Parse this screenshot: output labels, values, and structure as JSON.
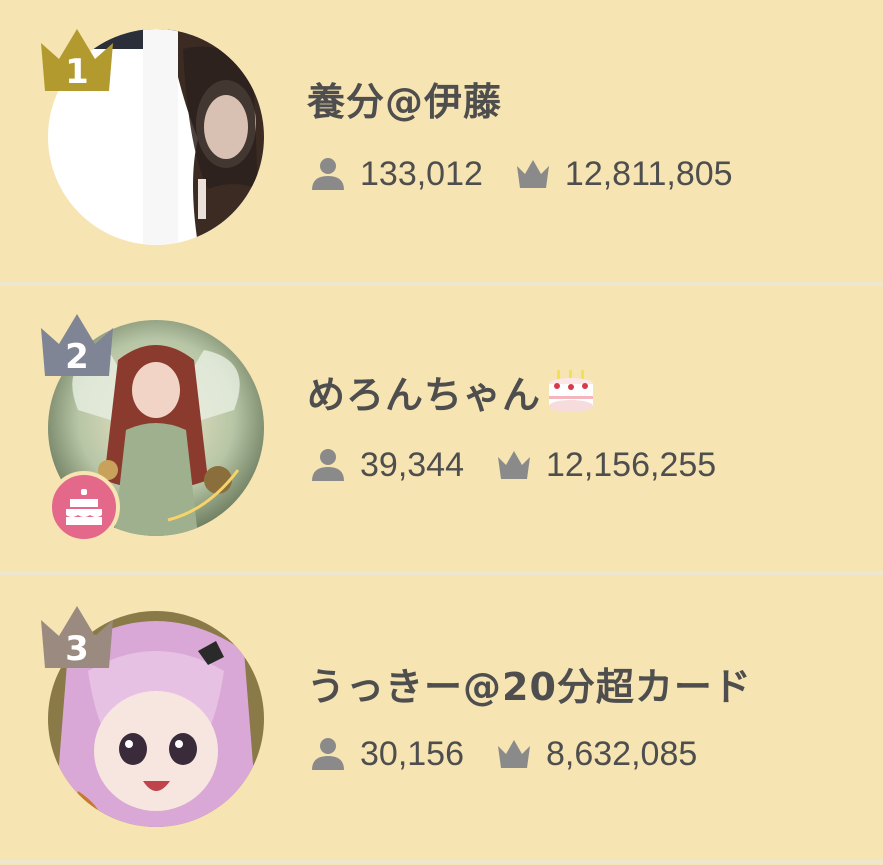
{
  "colors": {
    "background": "#f6e4b2",
    "divider": "#efe6cf",
    "text": "#4e4e4e",
    "icon": "#8a8a8a",
    "gold": "#b39a2e",
    "silver": "#7f8594",
    "bronze": "#9a8a7f",
    "birthday_badge": "#e3688a"
  },
  "ranking": [
    {
      "rank": "1",
      "name": "養分@伊藤",
      "followers": "133,012",
      "points": "12,811,805",
      "crown_color": "#b39a2e",
      "birthday": false
    },
    {
      "rank": "2",
      "name": "めろんちゃん",
      "name_emoji": "birthday-cake-icon",
      "followers": "39,344",
      "points": "12,156,255",
      "crown_color": "#7f8594",
      "birthday": true
    },
    {
      "rank": "3",
      "name": "うっきー@20分超カード",
      "followers": "30,156",
      "points": "8,632,085",
      "crown_color": "#9a8a7f",
      "birthday": false
    }
  ]
}
